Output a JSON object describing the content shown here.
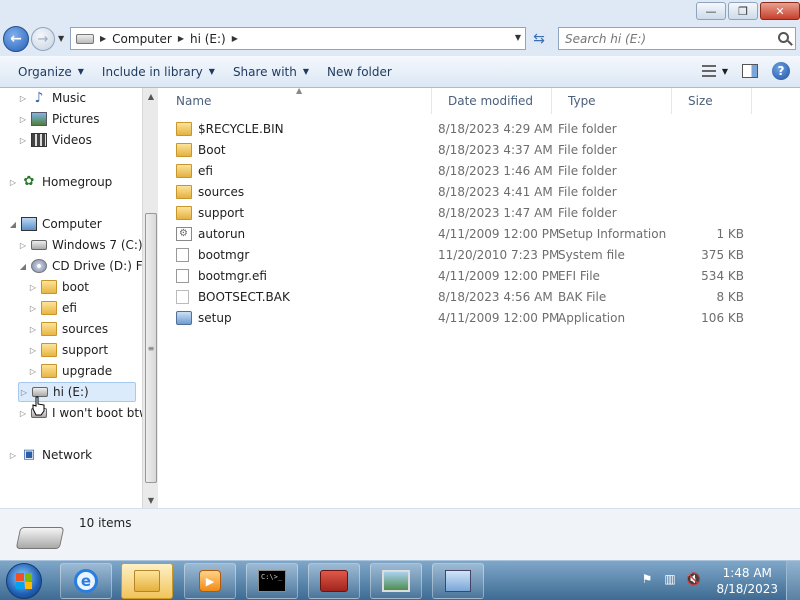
{
  "window": {
    "controls": {
      "minimize": "—",
      "maximize": "❐",
      "close": "✕"
    }
  },
  "address": {
    "crumbs": [
      "Computer",
      "hi (E:)"
    ],
    "search_placeholder": "Search hi (E:)"
  },
  "toolbar": {
    "organize": "Organize",
    "include_in_library": "Include in library",
    "share_with": "Share with",
    "new_folder": "New folder"
  },
  "nav": {
    "items": [
      {
        "label": "Music",
        "icon": "music-icon"
      },
      {
        "label": "Pictures",
        "icon": "pictures-icon"
      },
      {
        "label": "Videos",
        "icon": "videos-icon"
      },
      {
        "label": "Homegroup",
        "icon": "homegroup-icon"
      },
      {
        "label": "Computer",
        "icon": "computer-icon"
      },
      {
        "label": "Windows 7 (C:)",
        "icon": "drive-icon"
      },
      {
        "label": "CD Drive (D:) FRT",
        "icon": "cd-drive-icon"
      },
      {
        "label": "boot",
        "icon": "folder-icon"
      },
      {
        "label": "efi",
        "icon": "folder-icon"
      },
      {
        "label": "sources",
        "icon": "folder-icon"
      },
      {
        "label": "support",
        "icon": "folder-icon"
      },
      {
        "label": "upgrade",
        "icon": "folder-icon"
      },
      {
        "label": "hi (E:)",
        "icon": "drive-icon"
      },
      {
        "label": "I won't boot btw",
        "icon": "drive-icon"
      },
      {
        "label": "Network",
        "icon": "network-icon"
      }
    ]
  },
  "columns": {
    "name": "Name",
    "date": "Date modified",
    "type": "Type",
    "size": "Size"
  },
  "files": [
    {
      "name": "$RECYCLE.BIN",
      "date": "8/18/2023 4:29 AM",
      "type": "File folder",
      "size": "",
      "icon": "folder-icon"
    },
    {
      "name": "Boot",
      "date": "8/18/2023 4:37 AM",
      "type": "File folder",
      "size": "",
      "icon": "folder-icon"
    },
    {
      "name": "efi",
      "date": "8/18/2023 1:46 AM",
      "type": "File folder",
      "size": "",
      "icon": "folder-icon"
    },
    {
      "name": "sources",
      "date": "8/18/2023 4:41 AM",
      "type": "File folder",
      "size": "",
      "icon": "folder-icon"
    },
    {
      "name": "support",
      "date": "8/18/2023 1:47 AM",
      "type": "File folder",
      "size": "",
      "icon": "folder-icon"
    },
    {
      "name": "autorun",
      "date": "4/11/2009 12:00 PM",
      "type": "Setup Information",
      "size": "1 KB",
      "icon": "setup-info-icon"
    },
    {
      "name": "bootmgr",
      "date": "11/20/2010 7:23 PM",
      "type": "System file",
      "size": "375 KB",
      "icon": "system-file-icon"
    },
    {
      "name": "bootmgr.efi",
      "date": "4/11/2009 12:00 PM",
      "type": "EFI File",
      "size": "534 KB",
      "icon": "file-icon"
    },
    {
      "name": "BOOTSECT.BAK",
      "date": "8/18/2023 4:56 AM",
      "type": "BAK File",
      "size": "8 KB",
      "icon": "file-icon"
    },
    {
      "name": "setup",
      "date": "4/11/2009 12:00 PM",
      "type": "Application",
      "size": "106 KB",
      "icon": "application-icon"
    }
  ],
  "status": {
    "items_count": "10 items"
  },
  "taskbar": {
    "time": "1:48 AM",
    "date": "8/18/2023",
    "cmd_text": "C:\\>_"
  }
}
